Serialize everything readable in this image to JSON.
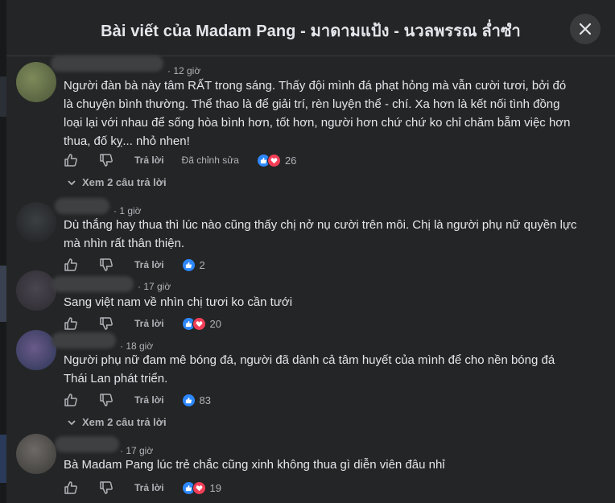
{
  "dialog": {
    "title": "Bài viết của Madam Pang - มาดามแป้ง - นวลพรรณ ล่ำซำ",
    "close_icon": "close-icon"
  },
  "actions": {
    "reply": "Trả lời",
    "edited": "Đã chỉnh sửa"
  },
  "comments": [
    {
      "time": "· 12 giờ",
      "text": "Người đàn bà này tâm RẤT trong sáng. Thấy đội mình đá phạt hỏng mà vẫn cười tươi, bởi đó là chuyện bình thường. Thể thao là để giải trí, rèn luyện thể - chí. Xa hơn là kết nối tình đồng loại lại với nhau để sống hòa bình hơn, tốt hơn, người hơn chứ chứ ko chỉ chăm bẵm việc hơn thua, đố kỵ... nhỏ nhen!",
      "reactions": [
        "like",
        "love"
      ],
      "count": "26",
      "edited": true,
      "view_replies": "Xem 2 câu trả lời"
    },
    {
      "time": "· 1 giờ",
      "text": "Dù thắng hay thua thì lúc nào cũng thấy chị nở nụ cười trên môi. Chị là người phụ nữ quyền lực mà nhìn rất thân thiện.",
      "reactions": [
        "like"
      ],
      "count": "2"
    },
    {
      "time": "· 17 giờ",
      "text": "Sang việt nam về nhìn chị tươi ko cần tưới",
      "reactions": [
        "like",
        "love"
      ],
      "count": "20"
    },
    {
      "time": "· 18 giờ",
      "text": "Người phụ nữ đam mê bóng đá, người đã dành cả tâm huyết của mình để cho nền bóng đá Thái Lan phát triển.",
      "reactions": [
        "like"
      ],
      "count": "83",
      "view_replies": "Xem 2 câu trả lời"
    },
    {
      "time": "· 17 giờ",
      "text": "Bà Madam Pang lúc trẻ chắc cũng xinh không thua gì diễn viên đâu nhỉ",
      "reactions": [
        "like",
        "love"
      ],
      "count": "19"
    }
  ],
  "colors": {
    "bg": "#242526",
    "text": "#e4e6eb",
    "muted": "#b0b3b8",
    "like": "#2d88ff",
    "love": "#f33e58"
  }
}
